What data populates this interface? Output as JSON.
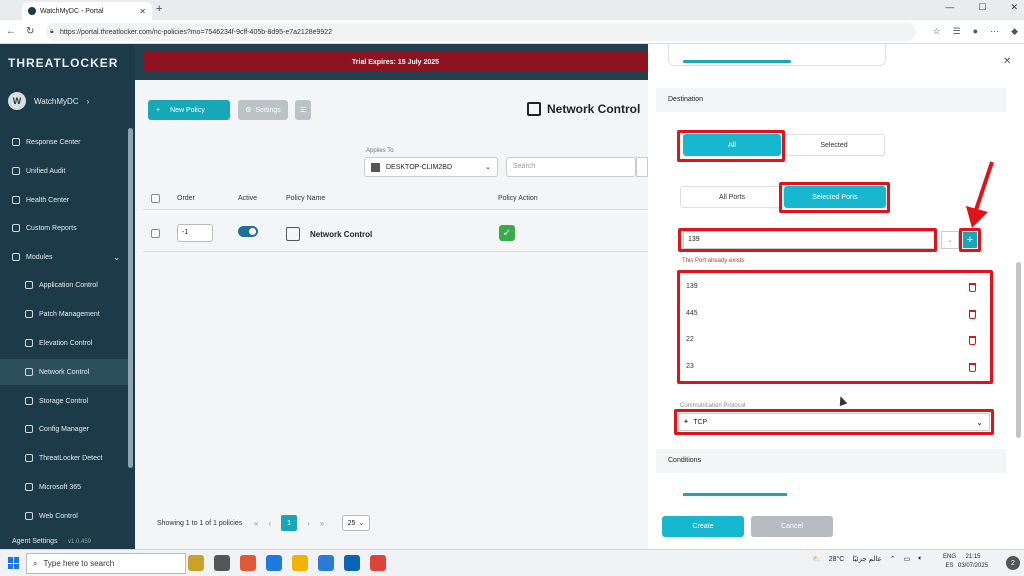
{
  "browser": {
    "tab_title": "WatchMyDC - Portal",
    "url": "https://portal.threatlocker.com/nc-policies?mo=7546234f-9cff-405b-8d95-e7a2128e9922"
  },
  "sidebar": {
    "logo": "THREATLOCKER",
    "user_initial": "W",
    "user_name": "WatchMyDC",
    "items": [
      {
        "label": "Response Center"
      },
      {
        "label": "Unified Audit"
      },
      {
        "label": "Health Center"
      },
      {
        "label": "Custom Reports"
      },
      {
        "label": "Modules"
      },
      {
        "label": "Application Control"
      },
      {
        "label": "Patch Management"
      },
      {
        "label": "Elevation Control"
      },
      {
        "label": "Network Control"
      },
      {
        "label": "Storage Control"
      },
      {
        "label": "Config Manager"
      },
      {
        "label": "ThreatLocker Detect"
      },
      {
        "label": "Microsoft 365"
      },
      {
        "label": "Web Control"
      },
      {
        "label": "Agent Settings"
      }
    ],
    "version": "v1.0.459"
  },
  "banner": {
    "text": "Trial Expires: 15 July 2025"
  },
  "toolbar": {
    "new_policy": "New Policy",
    "settings": "Settings"
  },
  "page": {
    "title": "Network Control"
  },
  "filters": {
    "applies_to_label": "Applies To",
    "device": "DESKTOP-CLIM2BD",
    "search_placeholder": "Search"
  },
  "table": {
    "headers": {
      "order": "Order",
      "active": "Active",
      "name": "Policy Name",
      "action": "Policy Action"
    },
    "rows": [
      {
        "order": "-1",
        "name": "Network Control",
        "active": true
      }
    ]
  },
  "pagination": {
    "showing": "Showing 1 to 1 of 1 policies",
    "current": "1",
    "per_page": "25"
  },
  "panel": {
    "destination_label": "Destination",
    "dest_all": "All",
    "dest_selected": "Selected",
    "all_ports": "All Ports",
    "selected_ports": "Selected Ports",
    "port_input_value": "139",
    "port_error": "This Port already exists",
    "ports": [
      "139",
      "445",
      "22",
      "23"
    ],
    "protocol_label": "Communication Protocol",
    "protocol_value": "TCP",
    "conditions_label": "Conditions",
    "create": "Create",
    "cancel": "Cancel"
  },
  "taskbar": {
    "search_placeholder": "Type here to search",
    "weather": "28°C",
    "weather_text": "عالم جزئيًا",
    "lang_top": "ENG",
    "lang_bottom": "ES",
    "time": "21:15",
    "date": "03/07/2025",
    "notif_count": "2"
  },
  "colors": {
    "accent": "#17b8cf",
    "sidebar": "#1c3a47",
    "banner": "#8e1320",
    "highlight": "#e0131a"
  }
}
